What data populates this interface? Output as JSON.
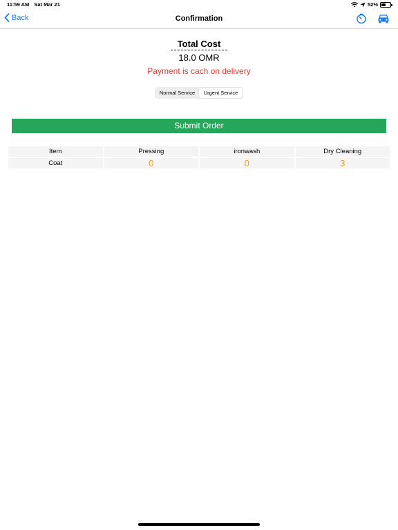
{
  "status_bar": {
    "time": "11:59 AM",
    "date": "Sat Mar 21",
    "battery_percent": "52%",
    "battery_level": 0.52
  },
  "nav": {
    "back_label": "Back",
    "title": "Confirmation"
  },
  "summary": {
    "title": "Total Cost",
    "amount": "18.0 OMR",
    "payment_note": "Payment is cach on delivery"
  },
  "service_type": {
    "options": [
      "Normal Service",
      "Urgent Service"
    ],
    "selected": "Urgent Service"
  },
  "submit_label": "Submit Order",
  "table": {
    "headers": [
      "Item",
      "Pressing",
      "ironwash",
      "Dry Cleaning"
    ],
    "rows": [
      {
        "item": "Coat",
        "pressing": "0",
        "ironwash": "0",
        "dry_cleaning": "3"
      }
    ]
  },
  "colors": {
    "accent": "#1a7cf0",
    "submit": "#25a65a",
    "warning": "#e8372f",
    "count": "#f39a1a"
  }
}
